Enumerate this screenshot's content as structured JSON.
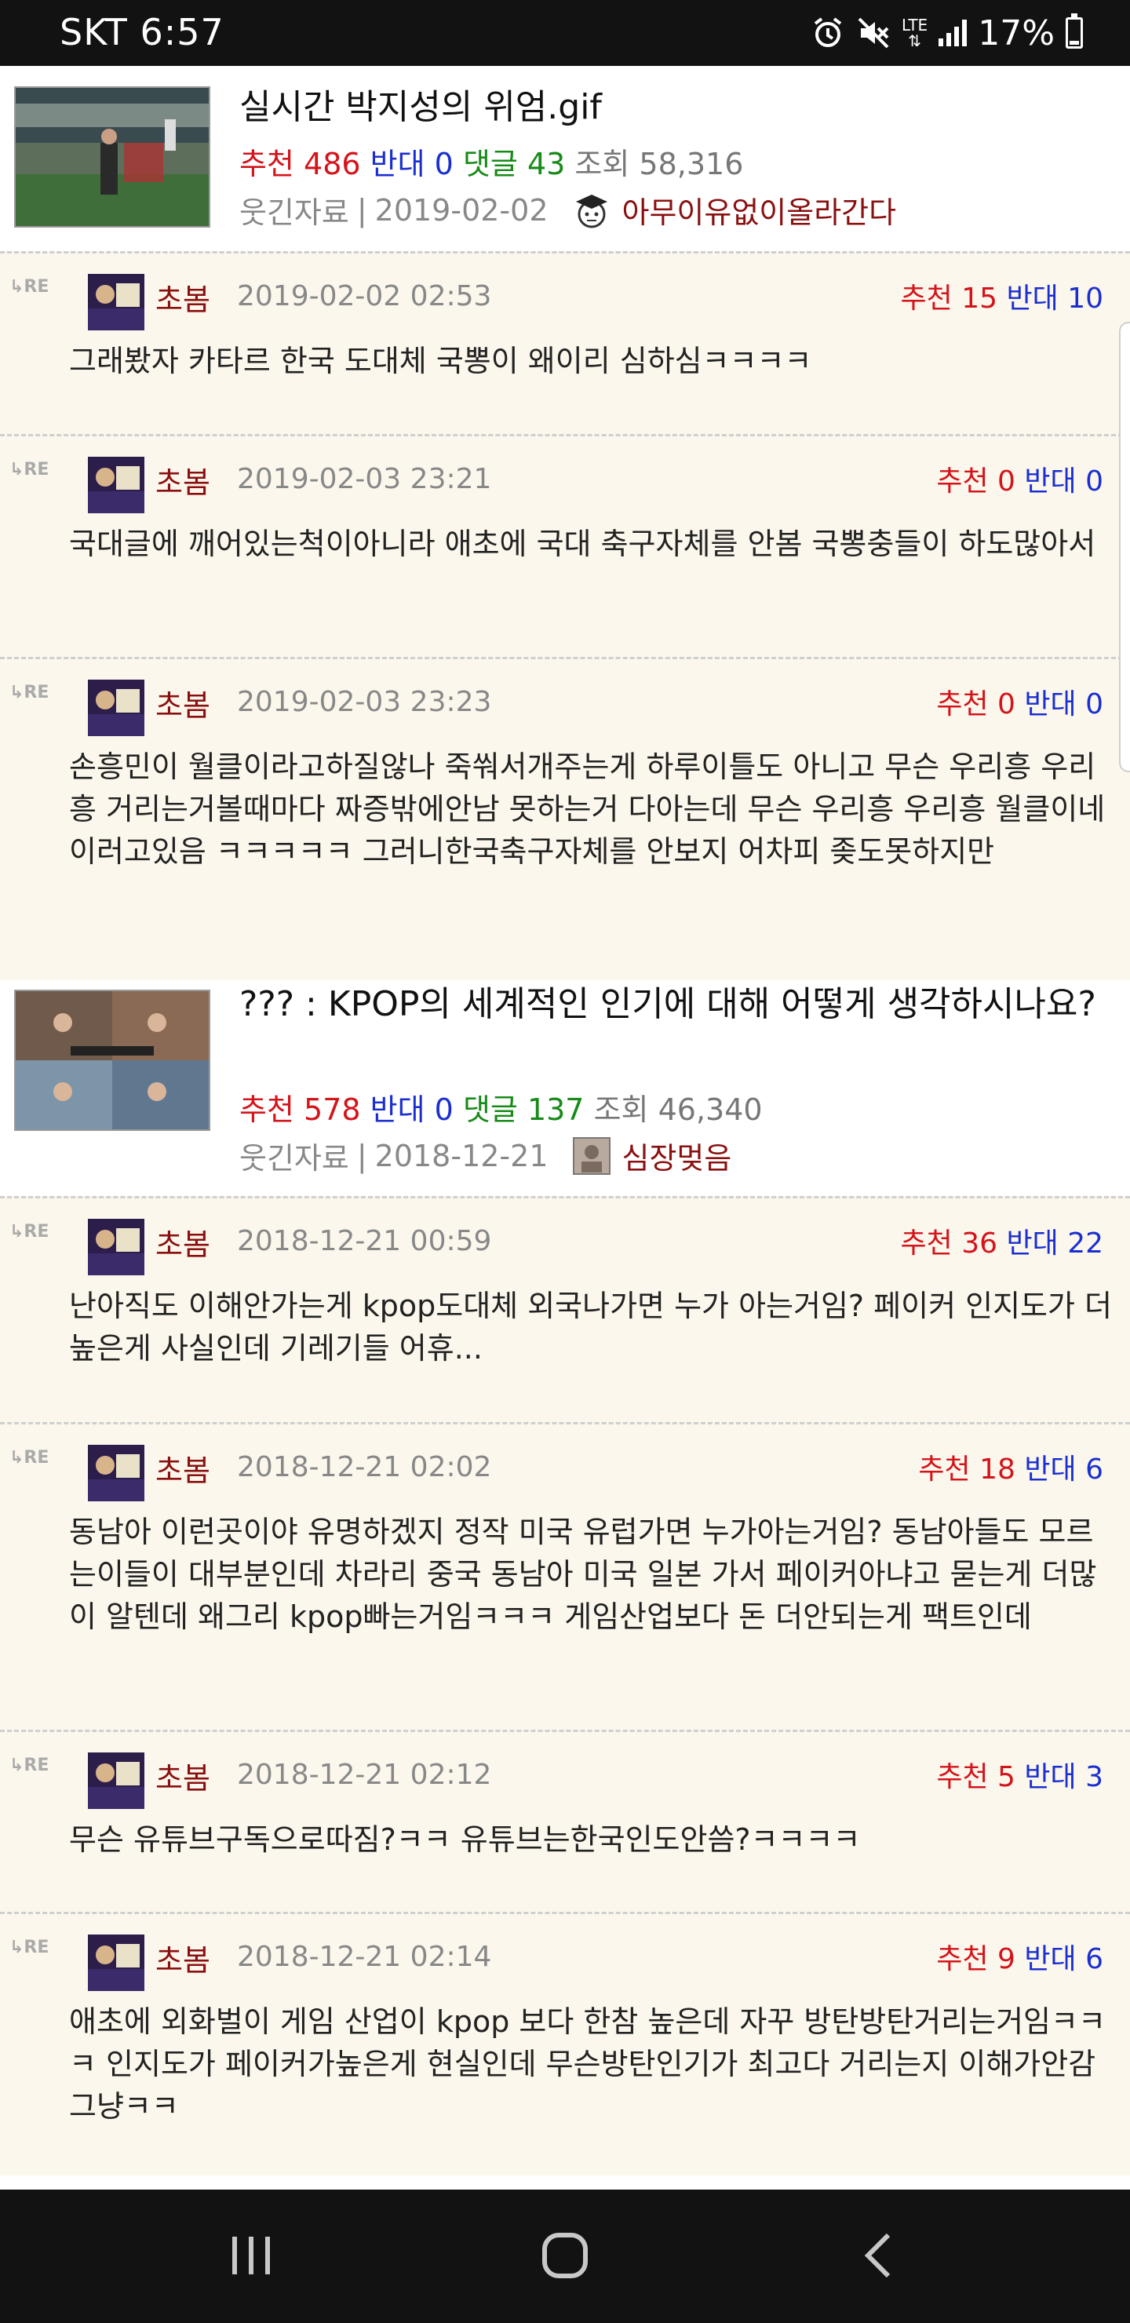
{
  "status": {
    "carrier_time": "SKT 6:57",
    "network": "LTE",
    "battery": "17%",
    "battery_level": 0.17
  },
  "posts": [
    {
      "title": "실시간 박지성의 위엄.gif",
      "rec_label": "추천",
      "rec": "486",
      "opp_label": "반대",
      "opp": "0",
      "cmt_label": "댓글",
      "cmt": "43",
      "view_label": "조회",
      "views": "58,316",
      "category": "웃긴자료",
      "date": "2019-02-02",
      "author": "아무이유없이올라간다",
      "comments": [
        {
          "name": "초봄",
          "date": "2019-02-02 02:53",
          "rec_label": "추천",
          "rec": "15",
          "opp_label": "반대",
          "opp": "10",
          "text": "그래봤자 카타르 한국 도대체 국뽕이 왜이리 심하심ㅋㅋㅋㅋ"
        },
        {
          "name": "초봄",
          "date": "2019-02-03 23:21",
          "rec_label": "추천",
          "rec": "0",
          "opp_label": "반대",
          "opp": "0",
          "text": "국대글에 깨어있는척이아니라 애초에 국대 축구자체를 안봄 국뽕충들이 하도많아서"
        },
        {
          "name": "초봄",
          "date": "2019-02-03 23:23",
          "rec_label": "추천",
          "rec": "0",
          "opp_label": "반대",
          "opp": "0",
          "text": "손흥민이 월클이라고하질않나 죽쒀서개주는게 하루이틀도 아니고 무슨 우리흥 우리흥 거리는거볼때마다 짜증밖에안남 못하는거 다아는데 무슨 우리흥 우리흥 월클이네 이러고있음 ㅋㅋㅋㅋㅋ 그러니한국축구자체를 안보지 어차피 좆도못하지만"
        }
      ]
    },
    {
      "title": "??? : KPOP의 세계적인 인기에 대해 어떻게 생각하시나요?",
      "rec_label": "추천",
      "rec": "578",
      "opp_label": "반대",
      "opp": "0",
      "cmt_label": "댓글",
      "cmt": "137",
      "view_label": "조회",
      "views": "46,340",
      "category": "웃긴자료",
      "date": "2018-12-21",
      "author": "심장멎음",
      "comments": [
        {
          "name": "초봄",
          "date": "2018-12-21 00:59",
          "rec_label": "추천",
          "rec": "36",
          "opp_label": "반대",
          "opp": "22",
          "text": "난아직도 이해안가는게 kpop도대체 외국나가면 누가 아는거임? 페이커 인지도가 더높은게 사실인데 기레기들 어휴..."
        },
        {
          "name": "초봄",
          "date": "2018-12-21 02:02",
          "rec_label": "추천",
          "rec": "18",
          "opp_label": "반대",
          "opp": "6",
          "text": "동남아 이런곳이야 유명하겠지 정작 미국 유럽가면 누가아는거임? 동남아들도 모르는이들이 대부분인데 차라리 중국 동남아 미국 일본 가서 페이커아냐고 묻는게 더많이 알텐데 왜그리 kpop빠는거임ㅋㅋㅋ 게임산업보다 돈 더안되는게 팩트인데"
        },
        {
          "name": "초봄",
          "date": "2018-12-21 02:12",
          "rec_label": "추천",
          "rec": "5",
          "opp_label": "반대",
          "opp": "3",
          "text": "무슨 유튜브구독으로따짐?ㅋㅋ 유튜브는한국인도안씀?ㅋㅋㅋㅋ"
        },
        {
          "name": "초봄",
          "date": "2018-12-21 02:14",
          "rec_label": "추천",
          "rec": "9",
          "opp_label": "반대",
          "opp": "6",
          "text": "애초에 외화벌이 게임 산업이 kpop 보다 한참 높은데 자꾸 방탄방탄거리는거임ㅋㅋㅋ 인지도가 페이커가높은게 현실인데 무슨방탄인기가 최고다 거리는지 이해가안감그냥ㅋㅋ"
        }
      ]
    }
  ],
  "icons": {
    "re": "reply-arrow-icon",
    "nav": [
      "recent-apps-icon",
      "home-icon",
      "back-icon"
    ]
  }
}
